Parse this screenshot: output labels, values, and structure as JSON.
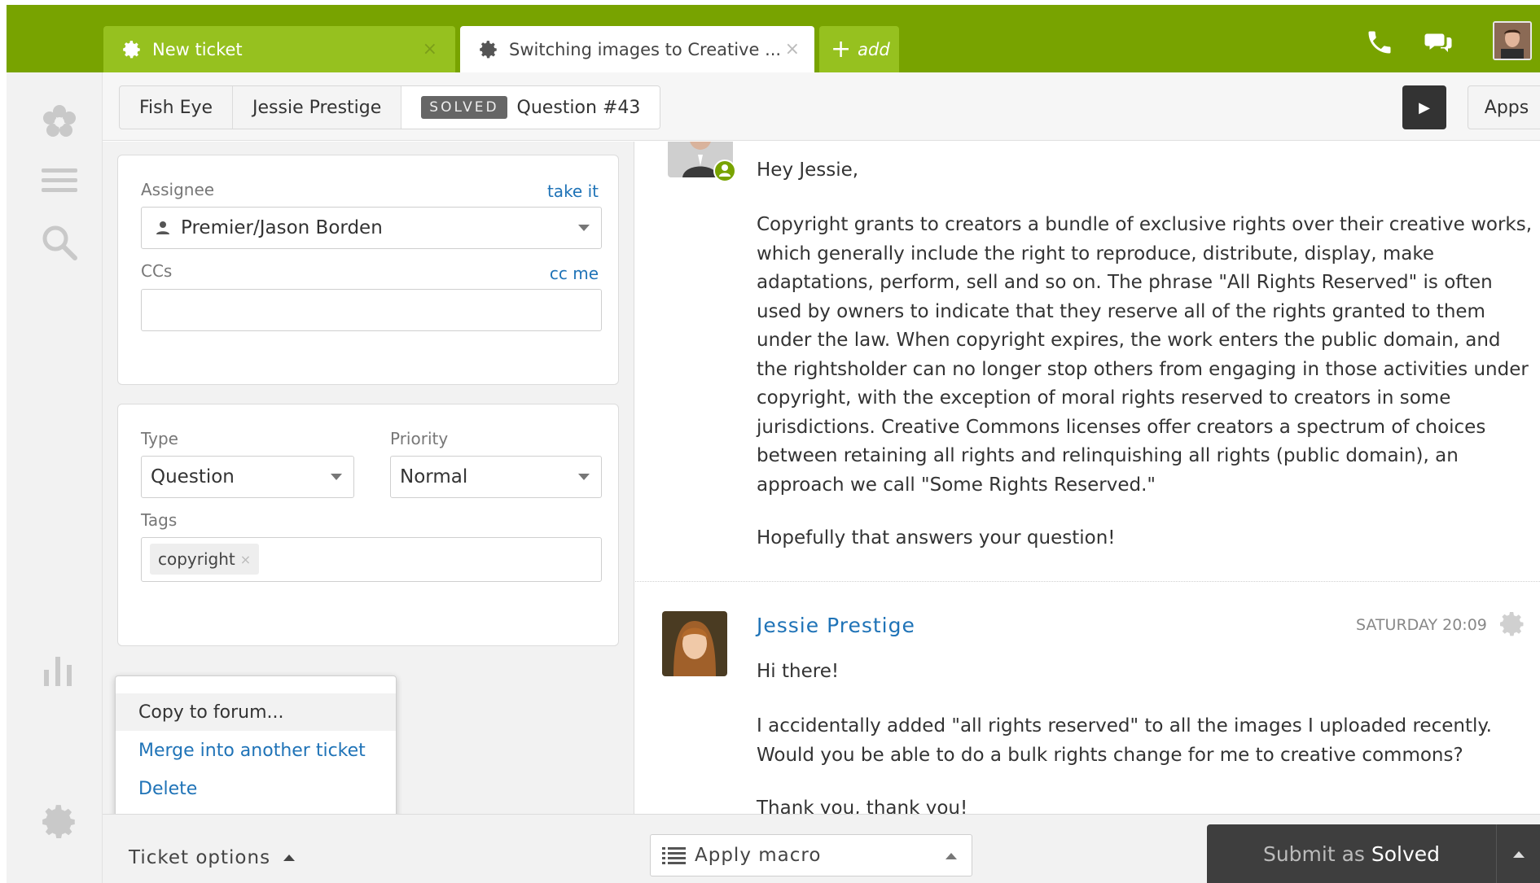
{
  "tabs": [
    {
      "label": "New ticket",
      "close": "×"
    },
    {
      "label": "Switching images to Creative ...",
      "close": "×"
    },
    {
      "label": "add",
      "plus": "+"
    }
  ],
  "breadcrumb": {
    "org": "Fish Eye",
    "requester": "Jessie Prestige",
    "status": "SOLVED",
    "ticket": "Question #43"
  },
  "toolbar": {
    "play": "▶",
    "apps": "Apps"
  },
  "fields": {
    "assignee_label": "Assignee",
    "take_it": "take it",
    "assignee_value": "Premier/Jason Borden",
    "ccs_label": "CCs",
    "cc_me": "cc me",
    "type_label": "Type",
    "type_value": "Question",
    "priority_label": "Priority",
    "priority_value": "Normal",
    "tags_label": "Tags",
    "tags": [
      {
        "label": "copyright",
        "remove": "×"
      }
    ]
  },
  "ticket_options_menu": {
    "items": [
      "Copy to forum...",
      "Merge into another ticket",
      "Delete"
    ]
  },
  "conversation": {
    "agent_reply": {
      "greeting": "Hey Jessie,",
      "lines": [
        "Copyright grants to creators a bundle of exclusive rights over their creative works,",
        "which generally include the right to reproduce, distribute, display, make",
        "adaptations, perform, sell and so on. The phrase \"All Rights Reserved\" is often",
        "used by owners to indicate that they reserve all of the rights granted to them",
        "under the law. When copyright expires, the work enters the public domain, and",
        "the rightsholder can no longer stop others from engaging in those activities under",
        "copyright, with the exception of moral rights reserved to creators in some",
        "jurisdictions. Creative Commons licenses offer creators a spectrum of choices",
        "between retaining all rights and relinquishing all rights (public domain), an",
        "approach we call \"Some Rights Reserved.\""
      ],
      "closing": "Hopefully that answers your question!"
    },
    "requester_message": {
      "author": "Jessie Prestige",
      "timestamp": "SATURDAY 20:09",
      "greeting": "Hi there!",
      "lines": [
        "I accidentally added \"all rights reserved\" to all the images I uploaded recently.",
        "Would you be able to do a bulk rights change for me to creative commons?"
      ],
      "closing": "Thank you, thank you!"
    }
  },
  "bottom": {
    "ticket_options": "Ticket options",
    "apply_macro": "Apply macro",
    "submit_prefix": "Submit as",
    "submit_status": "Solved"
  },
  "colors": {
    "brand_green": "#78a300",
    "tab_green": "#96c11f",
    "link_blue": "#1f73b7",
    "submit_dark": "#3e3e3e"
  }
}
